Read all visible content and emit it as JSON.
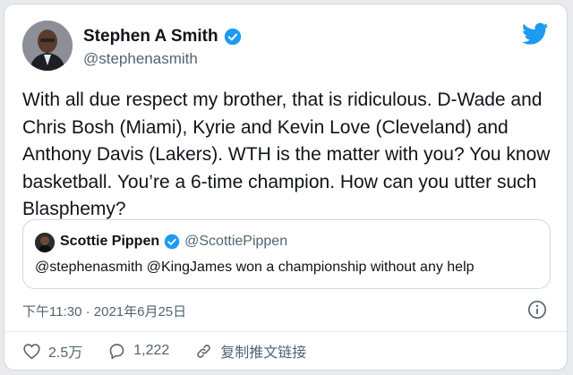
{
  "tweet": {
    "author": {
      "display_name": "Stephen A Smith",
      "handle": "@stephenasmith"
    },
    "text": "With all due respect my brother, that is ridiculous. D-Wade and Chris Bosh (Miami), Kyrie and Kevin Love (Cleveland) and Anthony Davis (Lakers). WTH is the matter with you? You know basketball. You’re a 6-time champion. How can you utter such Blasphemy?",
    "timestamp": "下午11:30 · 2021年6月25日"
  },
  "quoted_tweet": {
    "author": {
      "display_name": "Scottie Pippen",
      "handle": "@ScottiePippen"
    },
    "text": "@stephenasmith @KingJames won a championship without any help"
  },
  "actions": {
    "likes": "2.5万",
    "replies": "1,222",
    "copy_link": "复制推文链接"
  },
  "icons": {
    "logo": "twitter-bird-icon",
    "verified": "verified-badge-icon",
    "info": "info-icon",
    "like": "heart-icon",
    "reply": "reply-icon",
    "link": "link-icon"
  },
  "colors": {
    "brand": "#1d9bf0",
    "primary_text": "#0f1419",
    "secondary_text": "#536471",
    "border": "#cfd9de"
  }
}
